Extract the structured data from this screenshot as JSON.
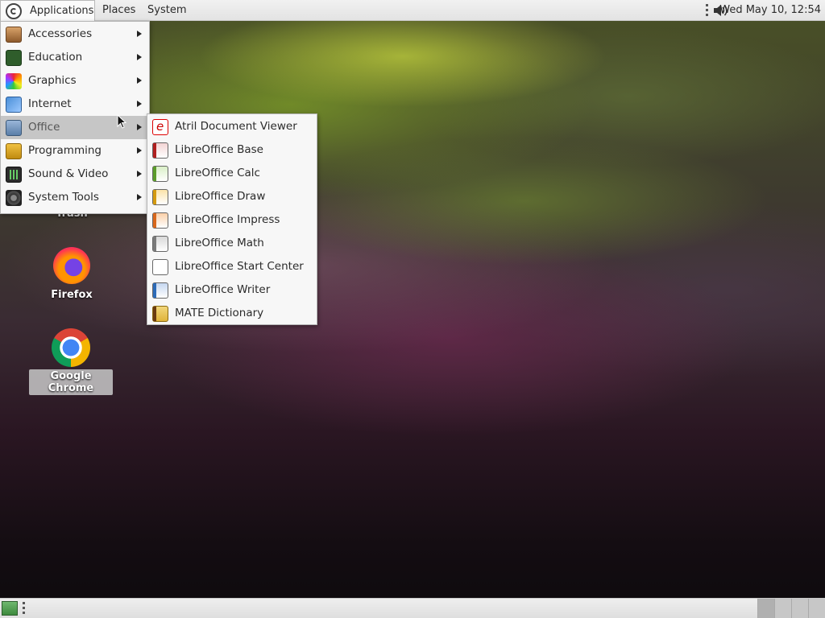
{
  "top_panel": {
    "menus": {
      "applications": "Applications",
      "places": "Places",
      "system": "System"
    },
    "clock": "Wed May 10, 12:54"
  },
  "applications_menu": {
    "items": [
      {
        "label": "Accessories",
        "icon": "accessories-icon"
      },
      {
        "label": "Education",
        "icon": "education-icon"
      },
      {
        "label": "Graphics",
        "icon": "graphics-icon"
      },
      {
        "label": "Internet",
        "icon": "internet-icon"
      },
      {
        "label": "Office",
        "icon": "office-icon",
        "active": true
      },
      {
        "label": "Programming",
        "icon": "programming-icon"
      },
      {
        "label": "Sound & Video",
        "icon": "sound-video-icon"
      },
      {
        "label": "System Tools",
        "icon": "system-tools-icon"
      }
    ]
  },
  "office_submenu": {
    "items": [
      {
        "label": "Atril Document Viewer",
        "icon": "atril-icon"
      },
      {
        "label": "LibreOffice Base",
        "icon": "libreoffice-base-icon"
      },
      {
        "label": "LibreOffice Calc",
        "icon": "libreoffice-calc-icon"
      },
      {
        "label": "LibreOffice Draw",
        "icon": "libreoffice-draw-icon"
      },
      {
        "label": "LibreOffice Impress",
        "icon": "libreoffice-impress-icon"
      },
      {
        "label": "LibreOffice Math",
        "icon": "libreoffice-math-icon"
      },
      {
        "label": "LibreOffice Start Center",
        "icon": "libreoffice-start-center-icon"
      },
      {
        "label": "LibreOffice Writer",
        "icon": "libreoffice-writer-icon"
      },
      {
        "label": "MATE Dictionary",
        "icon": "dictionary-icon"
      }
    ]
  },
  "desktop_icons": {
    "trash": "Trash",
    "firefox": "Firefox",
    "chrome": "Google Chrome"
  }
}
